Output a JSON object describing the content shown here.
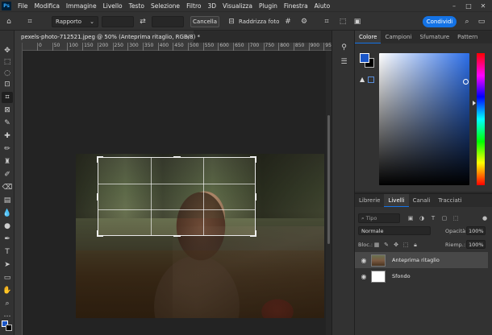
{
  "app": {
    "logo": "Ps"
  },
  "menubar": {
    "items": [
      "File",
      "Modifica",
      "Immagine",
      "Livello",
      "Testo",
      "Selezione",
      "Filtro",
      "3D",
      "Visualizza",
      "Plugin",
      "Finestra",
      "Aiuto"
    ]
  },
  "options": {
    "ratio_select": "Rapporto",
    "clear_button": "Cancella",
    "straighten_label": "Raddrizza foto",
    "share_button": "Condividi"
  },
  "document": {
    "tab_title": "pexels-photo-712521.jpeg @ 50% (Anteprima ritaglio, RGB/8) *",
    "tab_close": "×"
  },
  "ruler": {
    "ticks": [
      "0",
      "50",
      "100",
      "150",
      "200",
      "250",
      "300",
      "350",
      "400",
      "450",
      "500",
      "550",
      "600",
      "650",
      "700",
      "750",
      "800",
      "850",
      "900",
      "950"
    ]
  },
  "color_panel": {
    "tabs": [
      "Colore",
      "Campioni",
      "Sfumature",
      "Pattern"
    ],
    "active_tab": "Colore",
    "foreground_color": "#1a56c8",
    "background_color": "#000000"
  },
  "layers_panel": {
    "tabs": [
      "Librerie",
      "Livelli",
      "Canali",
      "Tracciati"
    ],
    "active_tab": "Livelli",
    "search_placeholder": "Tipo",
    "blend_mode": "Normale",
    "opacity_label": "Opacità:",
    "opacity_value": "100%",
    "lock_label": "Bloc.:",
    "fill_label": "Riemp.:",
    "fill_value": "100%",
    "layers": [
      {
        "name": "Anteprima ritaglio",
        "selected": true
      },
      {
        "name": "Sfondo",
        "selected": false
      }
    ]
  }
}
